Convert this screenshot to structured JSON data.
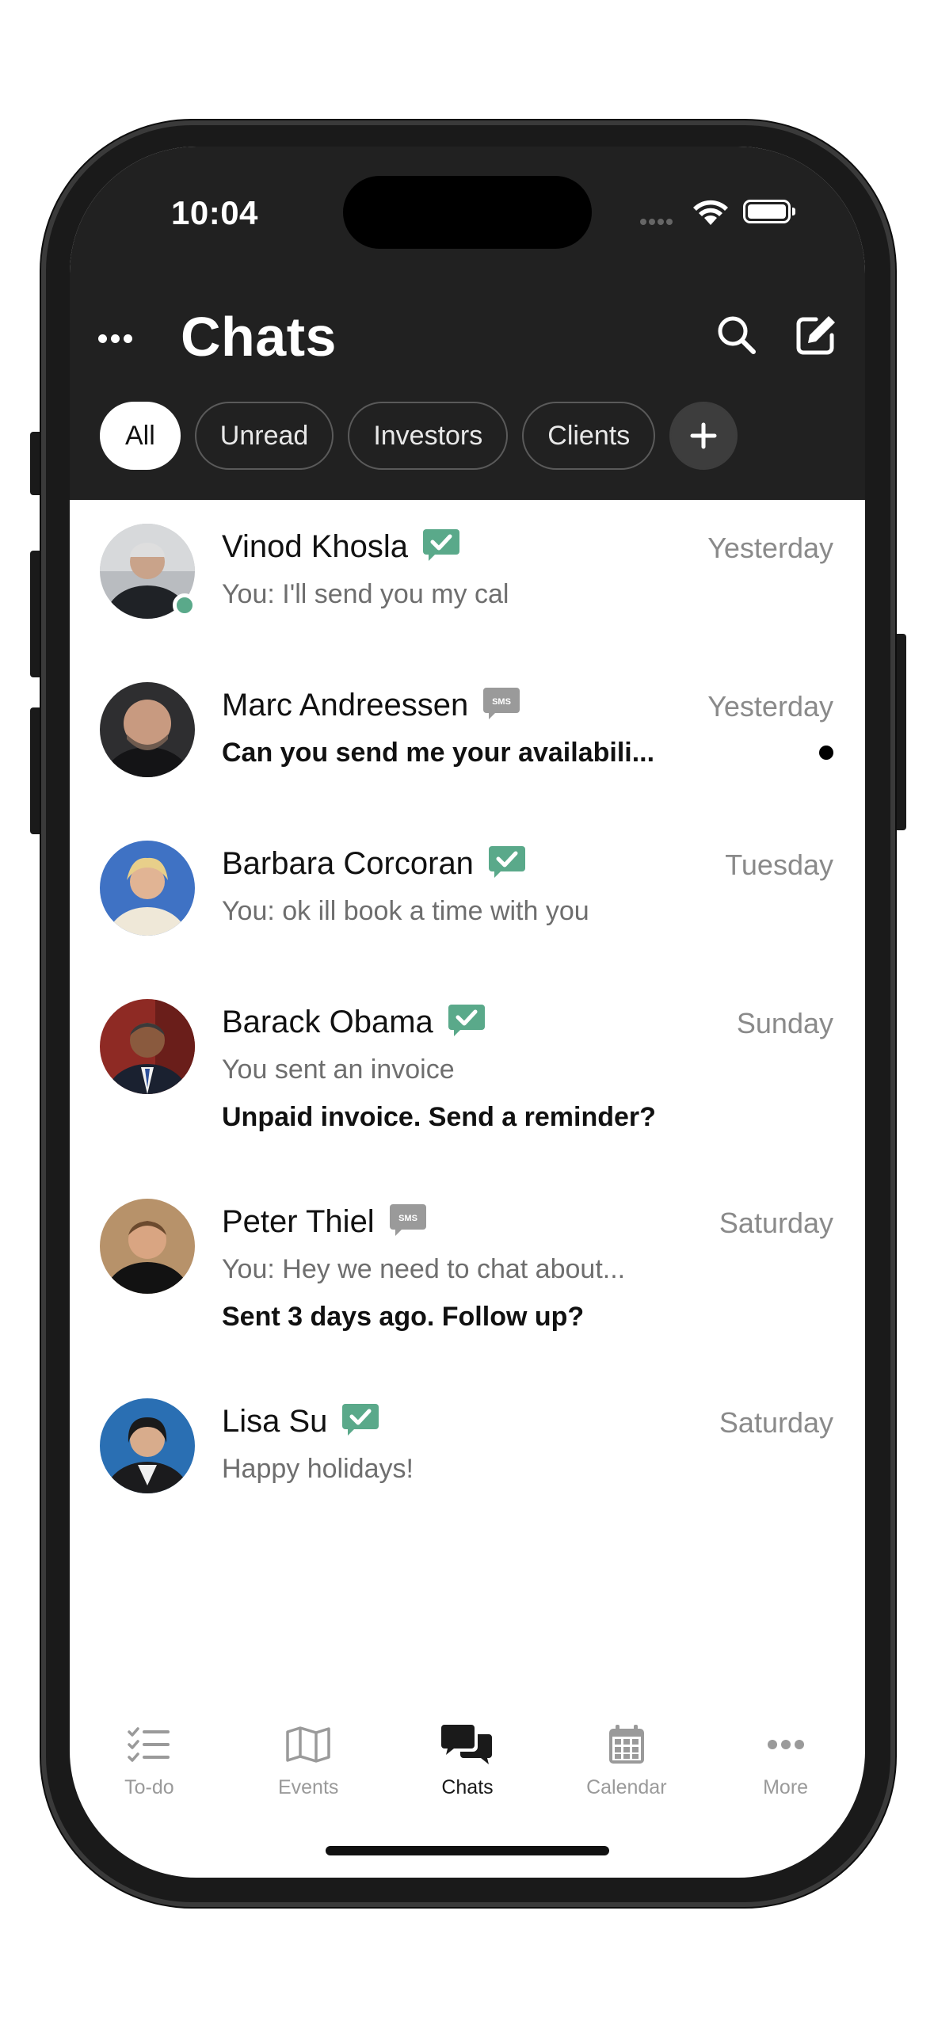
{
  "status_bar": {
    "time": "10:04"
  },
  "header": {
    "title": "Chats",
    "filters": [
      {
        "label": "All",
        "active": true
      },
      {
        "label": "Unread",
        "active": false
      },
      {
        "label": "Investors",
        "active": false
      },
      {
        "label": "Clients",
        "active": false
      }
    ],
    "add_filter_icon": "plus-icon"
  },
  "chats": [
    {
      "name": "Vinod Khosla",
      "badge": "verified",
      "time": "Yesterday",
      "preview": "You: I'll send you my cal",
      "online": true
    },
    {
      "name": "Marc Andreessen",
      "badge": "sms",
      "time": "Yesterday",
      "preview": "Can you send me your availabili...",
      "unread": true
    },
    {
      "name": "Barbara Corcoran",
      "badge": "verified",
      "time": "Tuesday",
      "preview": "You: ok ill book a time with you"
    },
    {
      "name": "Barack Obama",
      "badge": "verified",
      "time": "Sunday",
      "preview": "You sent an invoice",
      "nudge": "Unpaid invoice. Send a reminder?"
    },
    {
      "name": "Peter Thiel",
      "badge": "sms",
      "time": "Saturday",
      "preview": "You: Hey we need to chat about...",
      "nudge": "Sent 3 days ago. Follow up?"
    },
    {
      "name": "Lisa Su",
      "badge": "verified",
      "time": "Saturday",
      "preview": "Happy holidays!"
    }
  ],
  "tabs": [
    {
      "label": "To-do",
      "icon": "checklist-icon"
    },
    {
      "label": "Events",
      "icon": "map-icon"
    },
    {
      "label": "Chats",
      "icon": "chat-bubbles-icon",
      "active": true
    },
    {
      "label": "Calendar",
      "icon": "calendar-icon"
    },
    {
      "label": "More",
      "icon": "more-dots-icon"
    }
  ],
  "colors": {
    "header_bg": "#212121",
    "accent_green": "#5aa98a",
    "sms_badge": "#9a9a9a"
  }
}
